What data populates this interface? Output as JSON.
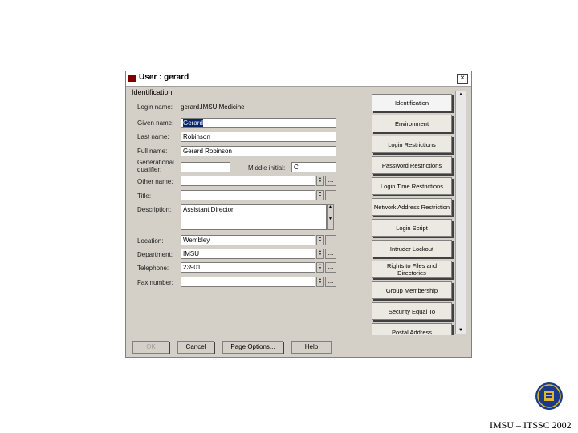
{
  "window": {
    "title": "User : gerard",
    "close_glyph": "×"
  },
  "page": {
    "title": "Identification"
  },
  "form": {
    "login_name_label": "Login name:",
    "login_name_value": "gerard.IMSU.Medicine",
    "given_name_label": "Given name:",
    "given_name_value": "Gerard",
    "last_name_label": "Last name:",
    "last_name_value": "Robinson",
    "full_name_label": "Full name:",
    "full_name_value": "Gerard Robinson",
    "generational_label_1": "Generational",
    "generational_label_2": "qualifier:",
    "generational_value": "",
    "middle_initial_label": "Middle initial:",
    "middle_initial_value": "C",
    "other_name_label": "Other name:",
    "other_name_value": "",
    "title_label": "Title:",
    "title_value": "",
    "description_label": "Description:",
    "description_value": "Assistant Director",
    "location_label": "Location:",
    "location_value": "Wembley",
    "department_label": "Department:",
    "department_value": "IMSU",
    "telephone_label": "Telephone:",
    "telephone_value": "23901",
    "fax_label": "Fax number:",
    "fax_value": "",
    "ellipsis": "..."
  },
  "tabs": [
    "Identification",
    "Environment",
    "Login Restrictions",
    "Password Restrictions",
    "Login Time Restrictions",
    "Network Address Restriction",
    "Login Script",
    "Intruder Lockout",
    "Rights to Files and Directories",
    "Group Membership",
    "Security Equal To",
    "Postal Address"
  ],
  "buttons": {
    "ok": "OK",
    "cancel": "Cancel",
    "page_options": "Page Options...",
    "help": "Help"
  },
  "footer": {
    "text": "IMSU – ITSSC 2002"
  },
  "colors": {
    "dialog_bg": "#d4d0c8",
    "selection": "#0a246a",
    "logo_blue": "#1c3a8a",
    "logo_gold": "#e0b830"
  }
}
